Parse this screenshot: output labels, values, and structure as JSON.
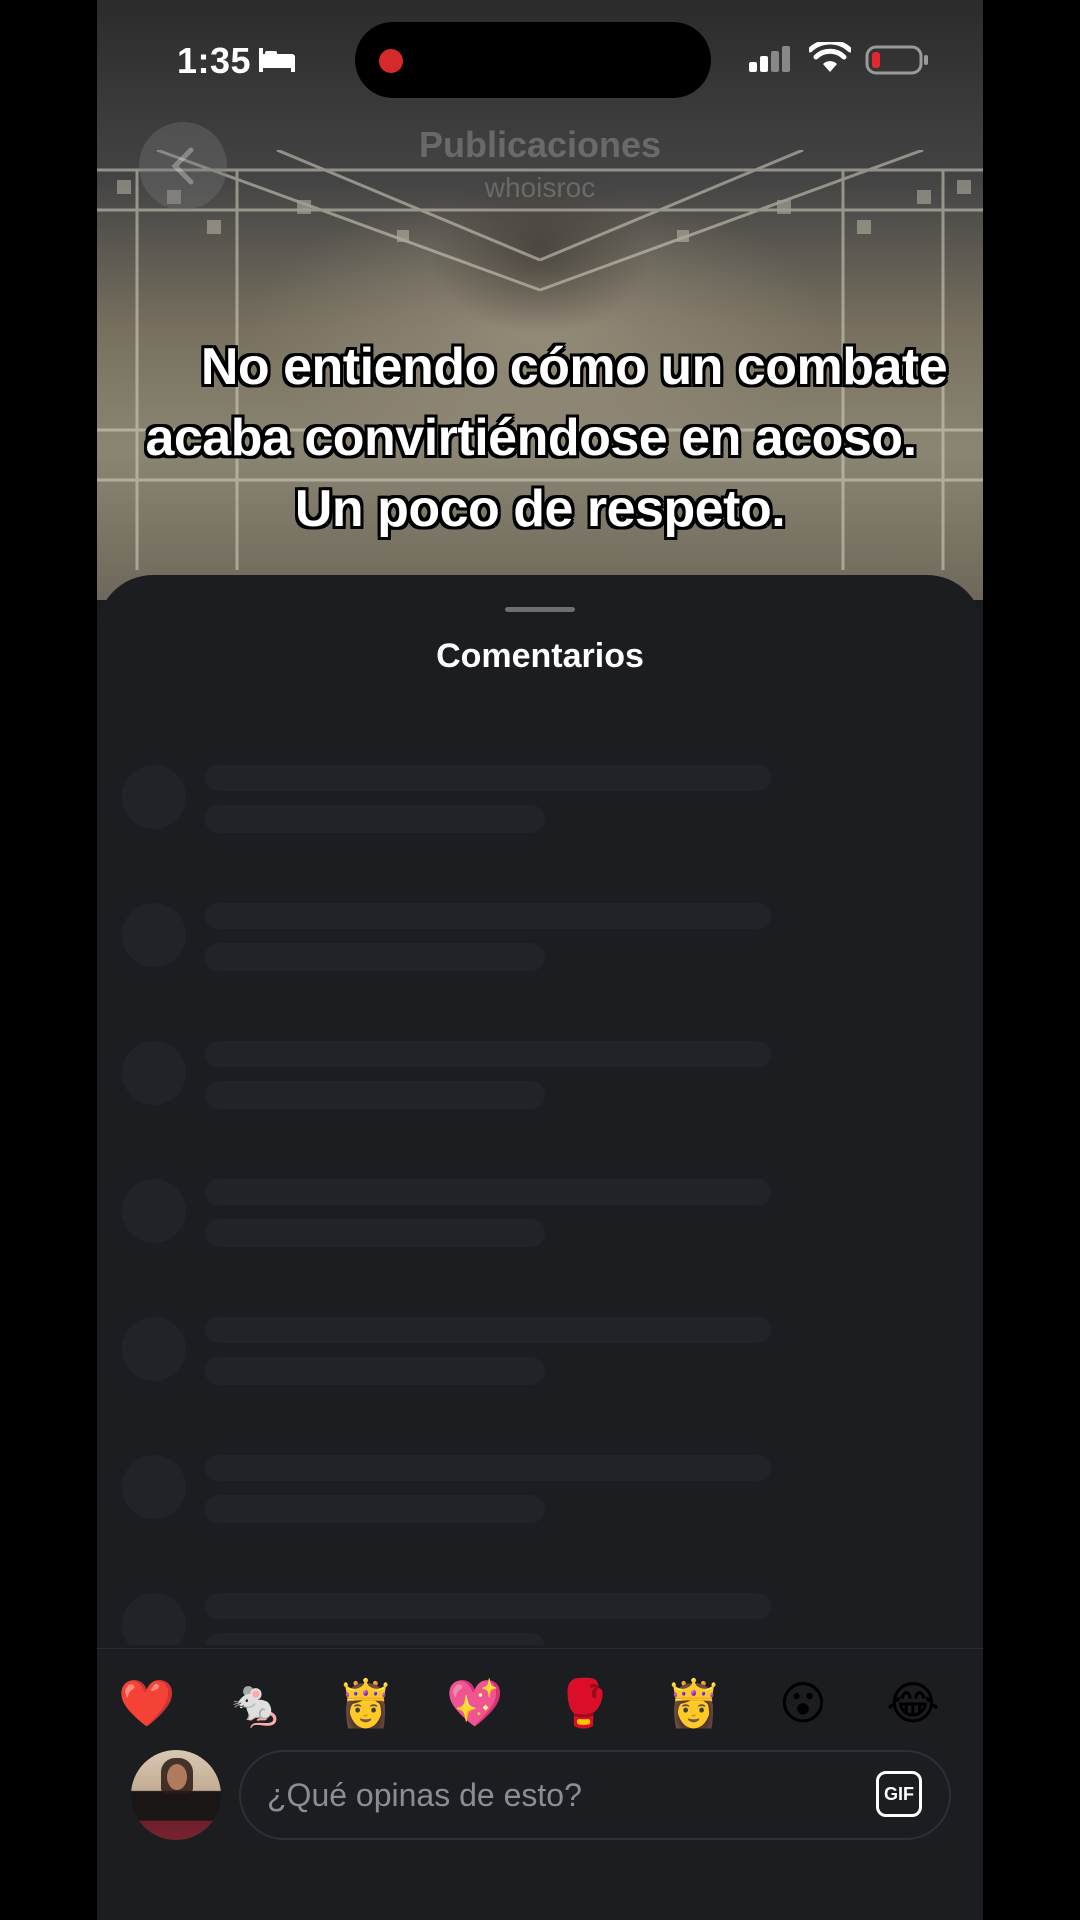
{
  "status_bar": {
    "time": "1:35",
    "icons": [
      "bed-icon",
      "recording-dot",
      "signal-icon",
      "wifi-icon",
      "battery-icon"
    ],
    "battery_color": "#e0282e",
    "recording_color": "#d42a2a"
  },
  "header": {
    "title": "Publicaciones",
    "subtitle": "whoisroc"
  },
  "caption": {
    "line1": "No entiendo cómo un combate",
    "line2": "acaba convirtiéndose en acoso.",
    "line3": "Un poco de respeto."
  },
  "comments_sheet": {
    "title": "Comentarios",
    "loading_placeholder_rows": 7
  },
  "emoji_bar": {
    "emojis": [
      "❤️",
      "🐁",
      "👸",
      "💖",
      "🥊",
      "👸",
      "😮",
      "😂"
    ]
  },
  "comment_input": {
    "placeholder": "¿Qué opinas de esto?",
    "gif_label": "GIF"
  },
  "colors": {
    "sheet_background": "#1c1d21",
    "skeleton": "#222328",
    "text": "#ffffff",
    "placeholder_text": "#8c8d92"
  }
}
